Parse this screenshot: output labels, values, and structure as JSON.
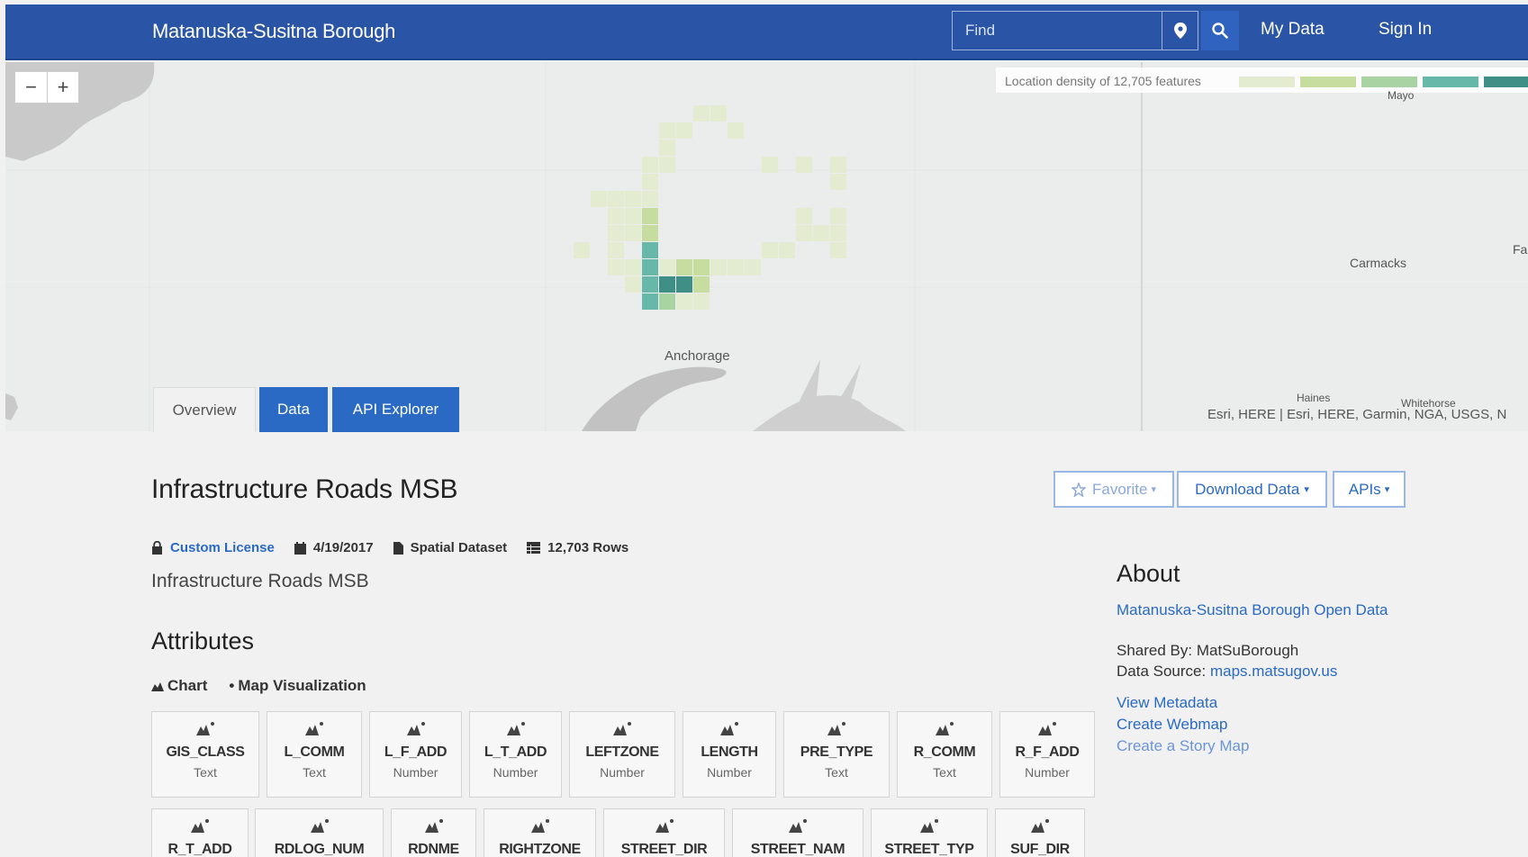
{
  "header": {
    "brand": "Matanuska-Susitna Borough",
    "search_placeholder": "Find",
    "my_data": "My Data",
    "sign_in": "Sign In"
  },
  "map": {
    "zoom_out": "−",
    "zoom_in": "+",
    "legend_label": "Location density of 12,705 features",
    "legend_colors": [
      "#e3ecd0",
      "#c6dd9f",
      "#a9d3a3",
      "#67b8a8",
      "#3f8f86"
    ],
    "cities": {
      "anchorage": "Anchorage",
      "mayo": "Mayo",
      "carmacks": "Carmacks",
      "haines": "Haines",
      "whitehorse": "Whitehorse",
      "faro": "Far"
    },
    "attribution": "Esri, HERE | Esri, HERE, Garmin, NGA, USGS, N"
  },
  "tabs": {
    "overview": "Overview",
    "data": "Data",
    "api": "API Explorer"
  },
  "dataset": {
    "title": "Infrastructure Roads MSB",
    "favorite": "Favorite",
    "download": "Download Data",
    "apis": "APIs",
    "license": "Custom License",
    "date": "4/19/2017",
    "type": "Spatial Dataset",
    "rows": "12,703 Rows",
    "description": "Infrastructure Roads MSB"
  },
  "attributes": {
    "heading": "Attributes",
    "chart": "Chart",
    "map_viz": "Map Visualization",
    "items": [
      {
        "name": "GIS_CLASS",
        "type": "Text"
      },
      {
        "name": "L_COMM",
        "type": "Text"
      },
      {
        "name": "L_F_ADD",
        "type": "Number"
      },
      {
        "name": "L_T_ADD",
        "type": "Number"
      },
      {
        "name": "LEFTZONE",
        "type": "Number"
      },
      {
        "name": "LENGTH",
        "type": "Number"
      },
      {
        "name": "PRE_TYPE",
        "type": "Text"
      },
      {
        "name": "R_COMM",
        "type": "Text"
      },
      {
        "name": "R_F_ADD",
        "type": "Number"
      },
      {
        "name": "R_T_ADD",
        "type": ""
      },
      {
        "name": "RDLOG_NUM",
        "type": ""
      },
      {
        "name": "RDNME",
        "type": ""
      },
      {
        "name": "RIGHTZONE",
        "type": ""
      },
      {
        "name": "STREET_DIR",
        "type": ""
      },
      {
        "name": "STREET_NAM",
        "type": ""
      },
      {
        "name": "STREET_TYP",
        "type": ""
      },
      {
        "name": "SUF_DIR",
        "type": ""
      }
    ]
  },
  "about": {
    "heading": "About",
    "org": "Matanuska-Susitna Borough Open Data",
    "shared_by": "Shared By: MatSuBorough",
    "source_label": "Data Source:",
    "source_link": "maps.matsugov.us",
    "metadata": "View Metadata",
    "webmap": "Create Webmap",
    "story": "Create a Story Map"
  }
}
